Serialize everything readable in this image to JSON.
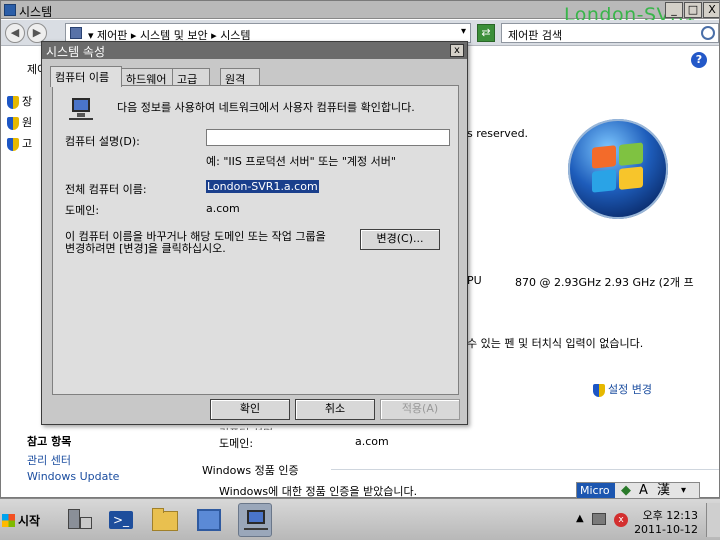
{
  "window": {
    "title": "시스템",
    "server_name": "London-SVR1",
    "breadcrumbs": [
      "제어판",
      "시스템 및 보안",
      "시스템"
    ],
    "search_placeholder": "제어판 검색",
    "minimize": "_",
    "maximize": "□",
    "close": "X"
  },
  "left_pane": {
    "partial_top": "제어",
    "items": [
      "장",
      "원",
      "고"
    ],
    "see_also_heading": "참고 항목",
    "see_also": [
      "관리 센터",
      "Windows Update"
    ]
  },
  "main": {
    "copyright_partial": "s reserved.",
    "processor_label_partial": "PU",
    "processor_value": "870  @ 2.93GHz   2.93 GHz (2개 프",
    "pen_text_partial": "수 있는 펜 및 터치식 입력이 없습니다.",
    "change_settings": "설정 변경",
    "domain_label_bg": "도메인:",
    "domain_value_bg": "a.com",
    "activation_heading": "Windows 정품 인증",
    "activation_text": "Windows에 대한 정품 인증을 받았습니다.",
    "partial_row": "컴퓨터 설명:"
  },
  "dialog": {
    "title": "시스템 속성",
    "close": "x",
    "tabs": [
      "컴퓨터 이름",
      "하드웨어",
      "고급",
      "원격"
    ],
    "intro_text": "다음 정보를 사용하여 네트워크에서 사용자 컴퓨터를 확인합니다.",
    "description_label": "컴퓨터 설명(D):",
    "description_value": "",
    "example_text": "예: \"IIS 프로덕션 서버\" 또는 \"계정 서버\"",
    "full_name_label": "전체 컴퓨터 이름:",
    "full_name_value": "London-SVR1.a.com",
    "domain_label": "도메인:",
    "domain_value": "a.com",
    "rename_text_line1": "이 컴퓨터 이름을 바꾸거나 해당 도메인 또는 작업 그룹을",
    "rename_text_line2": "변경하려면 [변경]을 클릭하십시오.",
    "change_button": "변경(C)...",
    "ok_button": "확인",
    "cancel_button": "취소",
    "apply_button": "적용(A)"
  },
  "taskbar": {
    "start_label": "시작",
    "clock_time": "오후 12:13",
    "clock_date": "2011-10-12",
    "language_bar": [
      "Micro",
      "A",
      "漢"
    ]
  }
}
